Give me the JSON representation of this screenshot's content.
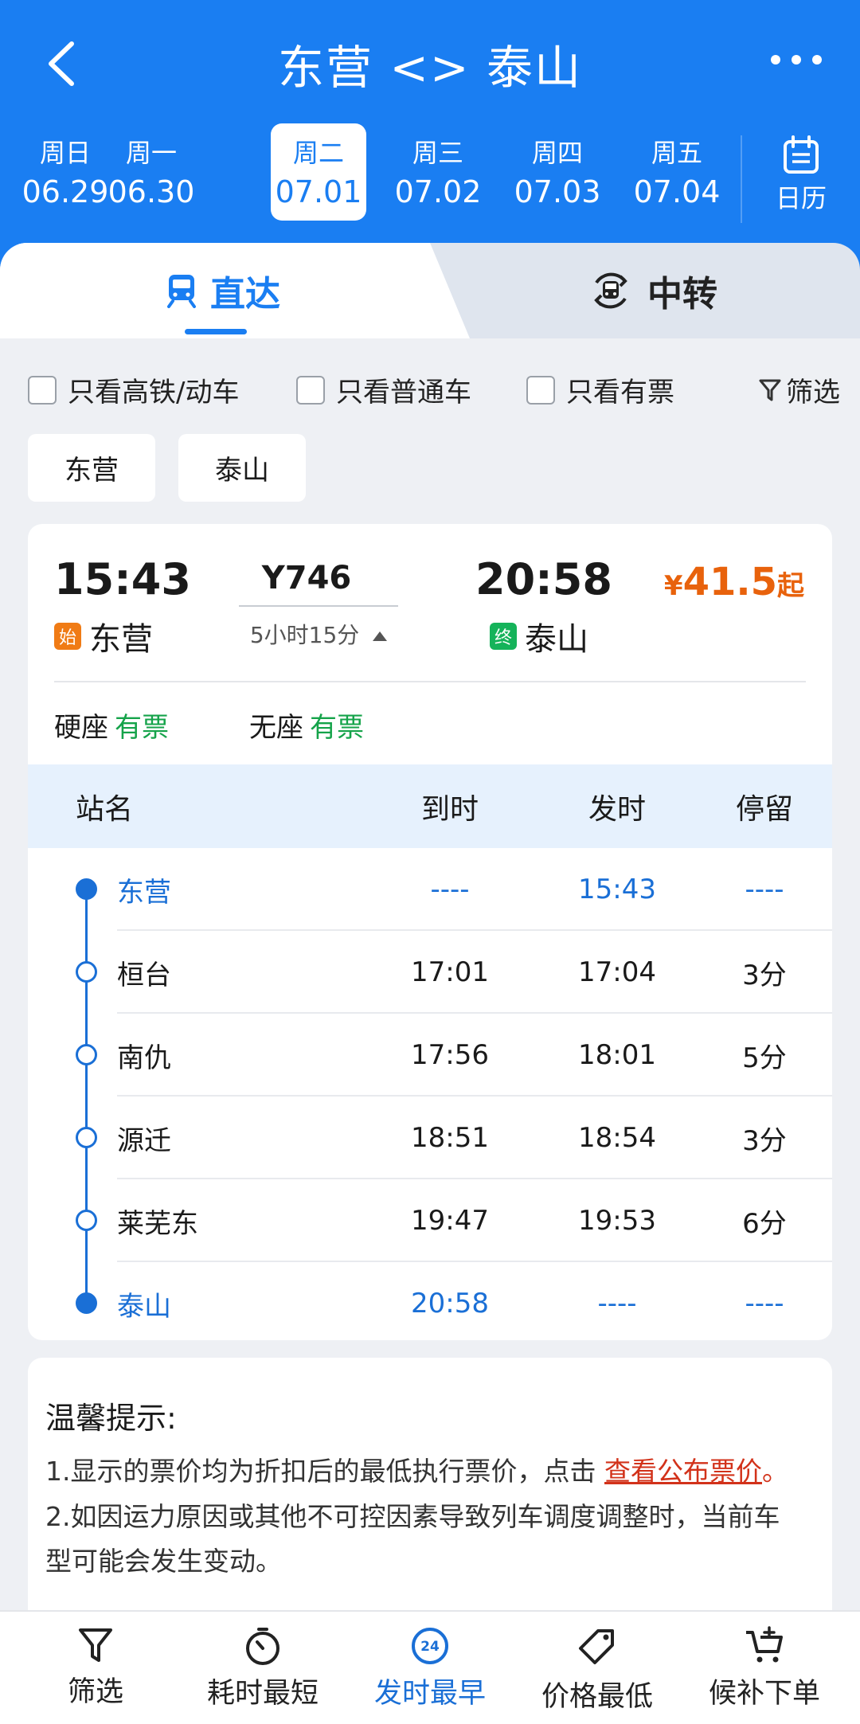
{
  "header": {
    "title": "东营 <> 泰山",
    "back_icon": "back-arrow-icon",
    "more_icon": "more-dots-icon"
  },
  "dates": [
    {
      "weekday": "周日",
      "date": "06.29"
    },
    {
      "weekday": "周一",
      "date": "06.30"
    },
    {
      "weekday": "周二",
      "date": "07.01",
      "selected": true
    },
    {
      "weekday": "周三",
      "date": "07.02"
    },
    {
      "weekday": "周四",
      "date": "07.03"
    },
    {
      "weekday": "周五",
      "date": "07.04"
    }
  ],
  "calendar": {
    "label": "日历",
    "icon": "calendar-icon"
  },
  "tabs": {
    "direct": {
      "label": "直达",
      "icon": "train-icon",
      "active": true
    },
    "transfer": {
      "label": "中转",
      "icon": "transfer-icon"
    }
  },
  "filters": {
    "high_speed": "只看高铁/动车",
    "normal": "只看普通车",
    "has_ticket": "只看有票",
    "filter_btn": "筛选"
  },
  "station_chips": [
    "东营",
    "泰山"
  ],
  "train": {
    "dep_time": "15:43",
    "dep_station": "东营",
    "start_tag": "始",
    "number": "Y746",
    "duration": "5小时15分",
    "arr_time": "20:58",
    "arr_station": "泰山",
    "end_tag": "终",
    "price_currency": "¥",
    "price_value": "41.5",
    "price_suffix": "起",
    "seats": [
      {
        "type": "硬座",
        "status": "有票"
      },
      {
        "type": "无座",
        "status": "有票"
      }
    ]
  },
  "stops_header": {
    "name": "站名",
    "arrive": "到时",
    "depart": "发时",
    "stay": "停留"
  },
  "stops": [
    {
      "name": "东营",
      "arrive": "----",
      "depart": "15:43",
      "stay": "----"
    },
    {
      "name": "桓台",
      "arrive": "17:01",
      "depart": "17:04",
      "stay": "3分"
    },
    {
      "name": "南仇",
      "arrive": "17:56",
      "depart": "18:01",
      "stay": "5分"
    },
    {
      "name": "源迁",
      "arrive": "18:51",
      "depart": "18:54",
      "stay": "3分"
    },
    {
      "name": "莱芜东",
      "arrive": "19:47",
      "depart": "19:53",
      "stay": "6分"
    },
    {
      "name": "泰山",
      "arrive": "20:58",
      "depart": "----",
      "stay": "----"
    }
  ],
  "tips": {
    "title": "温馨提示:",
    "line1_prefix": "1.显示的票价均为折扣后的最低执行票价，点击",
    "line1_link": "查看公布票价",
    "line1_suffix": "。",
    "line2": "2.如因运力原因或其他不可控因素导致列车调度调整时，当前车",
    "line3": "型可能会发生变动。"
  },
  "bottom_nav": [
    {
      "label": "筛选",
      "icon": "filter-icon"
    },
    {
      "label": "耗时最短",
      "icon": "stopwatch-icon"
    },
    {
      "label": "发时最早",
      "icon": "clock-24-icon",
      "active": true
    },
    {
      "label": "价格最低",
      "icon": "price-tag-icon"
    },
    {
      "label": "候补下单",
      "icon": "cart-add-icon"
    }
  ],
  "colors": {
    "primary": "#1a7ef2",
    "price": "#e8620c",
    "available": "#15a34a",
    "link": "#d2321a"
  }
}
